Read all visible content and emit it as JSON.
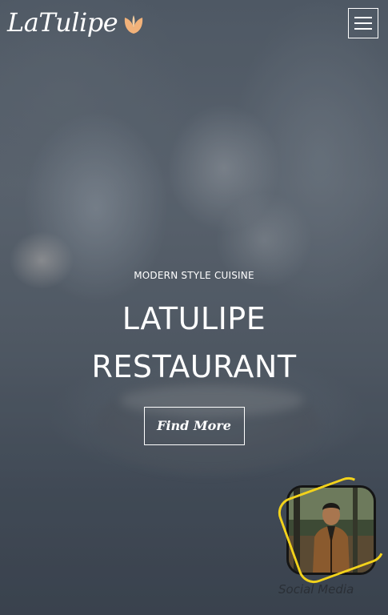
{
  "header": {
    "logo_text": "LaTulipe",
    "logo_icon": "tulip-leaf-icon",
    "menu_icon": "hamburger-menu-icon"
  },
  "hero": {
    "subtitle": "MODERN STYLE CUISINE",
    "title_line1": "LATULIPE",
    "title_line2": "RESTAURANT",
    "cta_label": "Find More"
  },
  "social_widget": {
    "label": "Social Media",
    "avatar": "profile-avatar"
  },
  "colors": {
    "logo_icon": "#f2b27a",
    "ring_accent": "#f2d21b",
    "text": "#ffffff"
  }
}
